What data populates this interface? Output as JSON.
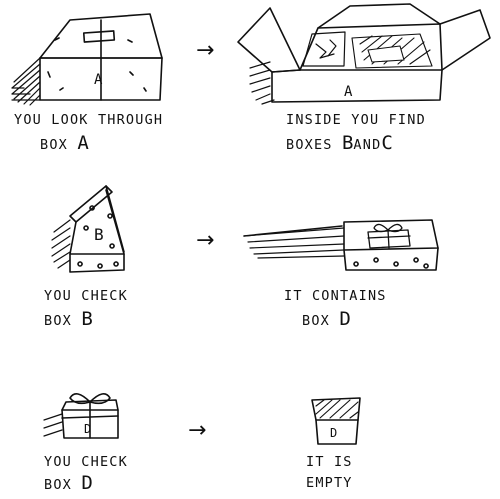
{
  "steps": [
    {
      "left": {
        "line1": "YOU LOOK THROUGH",
        "line2_pre": "BOX",
        "letter": "A"
      },
      "right": {
        "line1": "INSIDE YOU FIND",
        "line2_pre": "BOXES",
        "letter_b": "B",
        "and": "AND",
        "letter_c": "C"
      }
    },
    {
      "left": {
        "line1": "YOU CHECK",
        "line2_pre": "BOX",
        "letter": "B"
      },
      "right": {
        "line1": "IT CONTAINS",
        "line2_pre": "BOX",
        "letter": "D"
      }
    },
    {
      "left": {
        "line1": "YOU CHECK",
        "line2_pre": "BOX",
        "letter": "D"
      },
      "right": {
        "line1": "IT IS",
        "line2": "EMPTY"
      }
    }
  ],
  "box_labels": {
    "a": "A",
    "b": "B",
    "d": "D"
  },
  "arrow_glyph": "→",
  "colors": {
    "ink": "#111111",
    "paper": "#ffffff"
  }
}
